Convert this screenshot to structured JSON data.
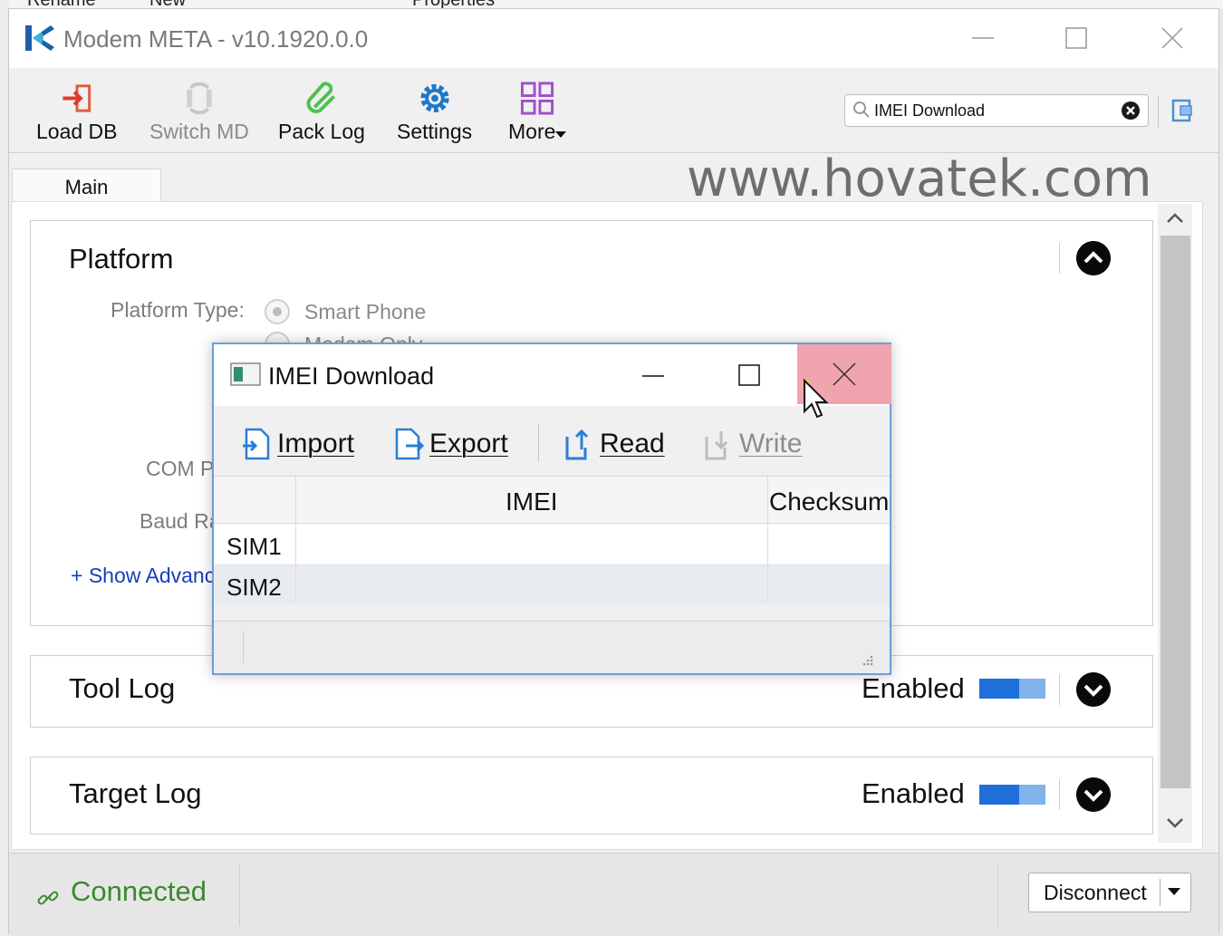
{
  "explorer_strip": {
    "items": [
      "Rename",
      "New",
      "Properties"
    ]
  },
  "titlebar": {
    "app_title": "Modem META - v10.1920.0.0"
  },
  "toolbar": {
    "buttons": [
      {
        "label": "Load DB",
        "icon": "load-db-icon",
        "enabled": true
      },
      {
        "label": "Switch MD",
        "icon": "switch-md-icon",
        "enabled": false
      },
      {
        "label": "Pack Log",
        "icon": "paperclip-icon",
        "enabled": true
      },
      {
        "label": "Settings",
        "icon": "gear-icon",
        "enabled": true
      },
      {
        "label": "More",
        "icon": "grid-icon",
        "enabled": true
      }
    ],
    "search": {
      "value": "IMEI Download"
    }
  },
  "tabs": {
    "main": "Main"
  },
  "watermark": "www.hovatek.com",
  "platform": {
    "title": "Platform",
    "platform_type_label": "Platform Type:",
    "options": [
      "Smart Phone",
      "Modem Only"
    ],
    "com_label": "COM P",
    "baud_label": "Baud Ra",
    "show_advanced": "+ Show Advanc"
  },
  "tool_log": {
    "title": "Tool Log",
    "status": "Enabled"
  },
  "target_log": {
    "title": "Target Log",
    "status": "Enabled"
  },
  "statusbar": {
    "status": "Connected",
    "disconnect_label": "Disconnect"
  },
  "dialog": {
    "title": "IMEI Download",
    "buttons": {
      "import": "Import",
      "export": "Export",
      "read": "Read",
      "write": "Write"
    },
    "columns": [
      "",
      "IMEI",
      "Checksum"
    ],
    "rows": [
      {
        "label": "SIM1",
        "imei": "",
        "checksum": ""
      },
      {
        "label": "SIM2",
        "imei": "",
        "checksum": ""
      }
    ]
  },
  "colors": {
    "accent": "#1e6fd9",
    "connected": "#3a8a2b",
    "close_hover": "#f0a4ad"
  }
}
